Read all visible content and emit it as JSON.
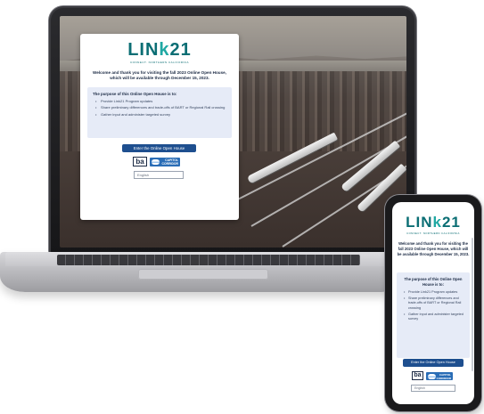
{
  "brand": {
    "logo_text_prefix": "LIN",
    "logo_text_accent": "k",
    "logo_text_suffix": "21",
    "tagline": "CONNECT. NORTHERN CALIFORNIA",
    "primary_color": "#0b6e74",
    "accent_color": "#1fa8a3",
    "button_color": "#1e4f8f",
    "panel_color": "#e6ebf7"
  },
  "laptop": {
    "welcome": "Welcome and thank you for visiting the fall 2023 Online Open House, which will be available through December 15, 2023.",
    "purpose_title": "The purpose of this Online Open House is to:",
    "bullets": [
      "Provide Link21 Program updates",
      "Share preliminary differences and trade-offs of BART or Regional Rail crossing",
      "Gather input and administer targeted survey"
    ],
    "enter_button": "Enter the Online Open House",
    "partner_logos": {
      "bart": "ba",
      "capitol_corridor": "CAPITOL CORRIDOR"
    },
    "language_value": "English"
  },
  "phone": {
    "welcome": "Welcome and thank you for visiting the fall 2023 Online Open House, which will be available through December 15, 2023.",
    "purpose_title": "The purpose of this Online Open House is to:",
    "bullets": [
      "Provide Link21 Program updates",
      "Share preliminary differences and trade-offs of BART or Regional Rail crossing",
      "Gather input and administer targeted survey"
    ],
    "enter_button": "Enter the Online Open House",
    "partner_logos": {
      "bart": "ba",
      "capitol_corridor": "CAPITOL CORRIDOR"
    },
    "language_value": "English"
  }
}
